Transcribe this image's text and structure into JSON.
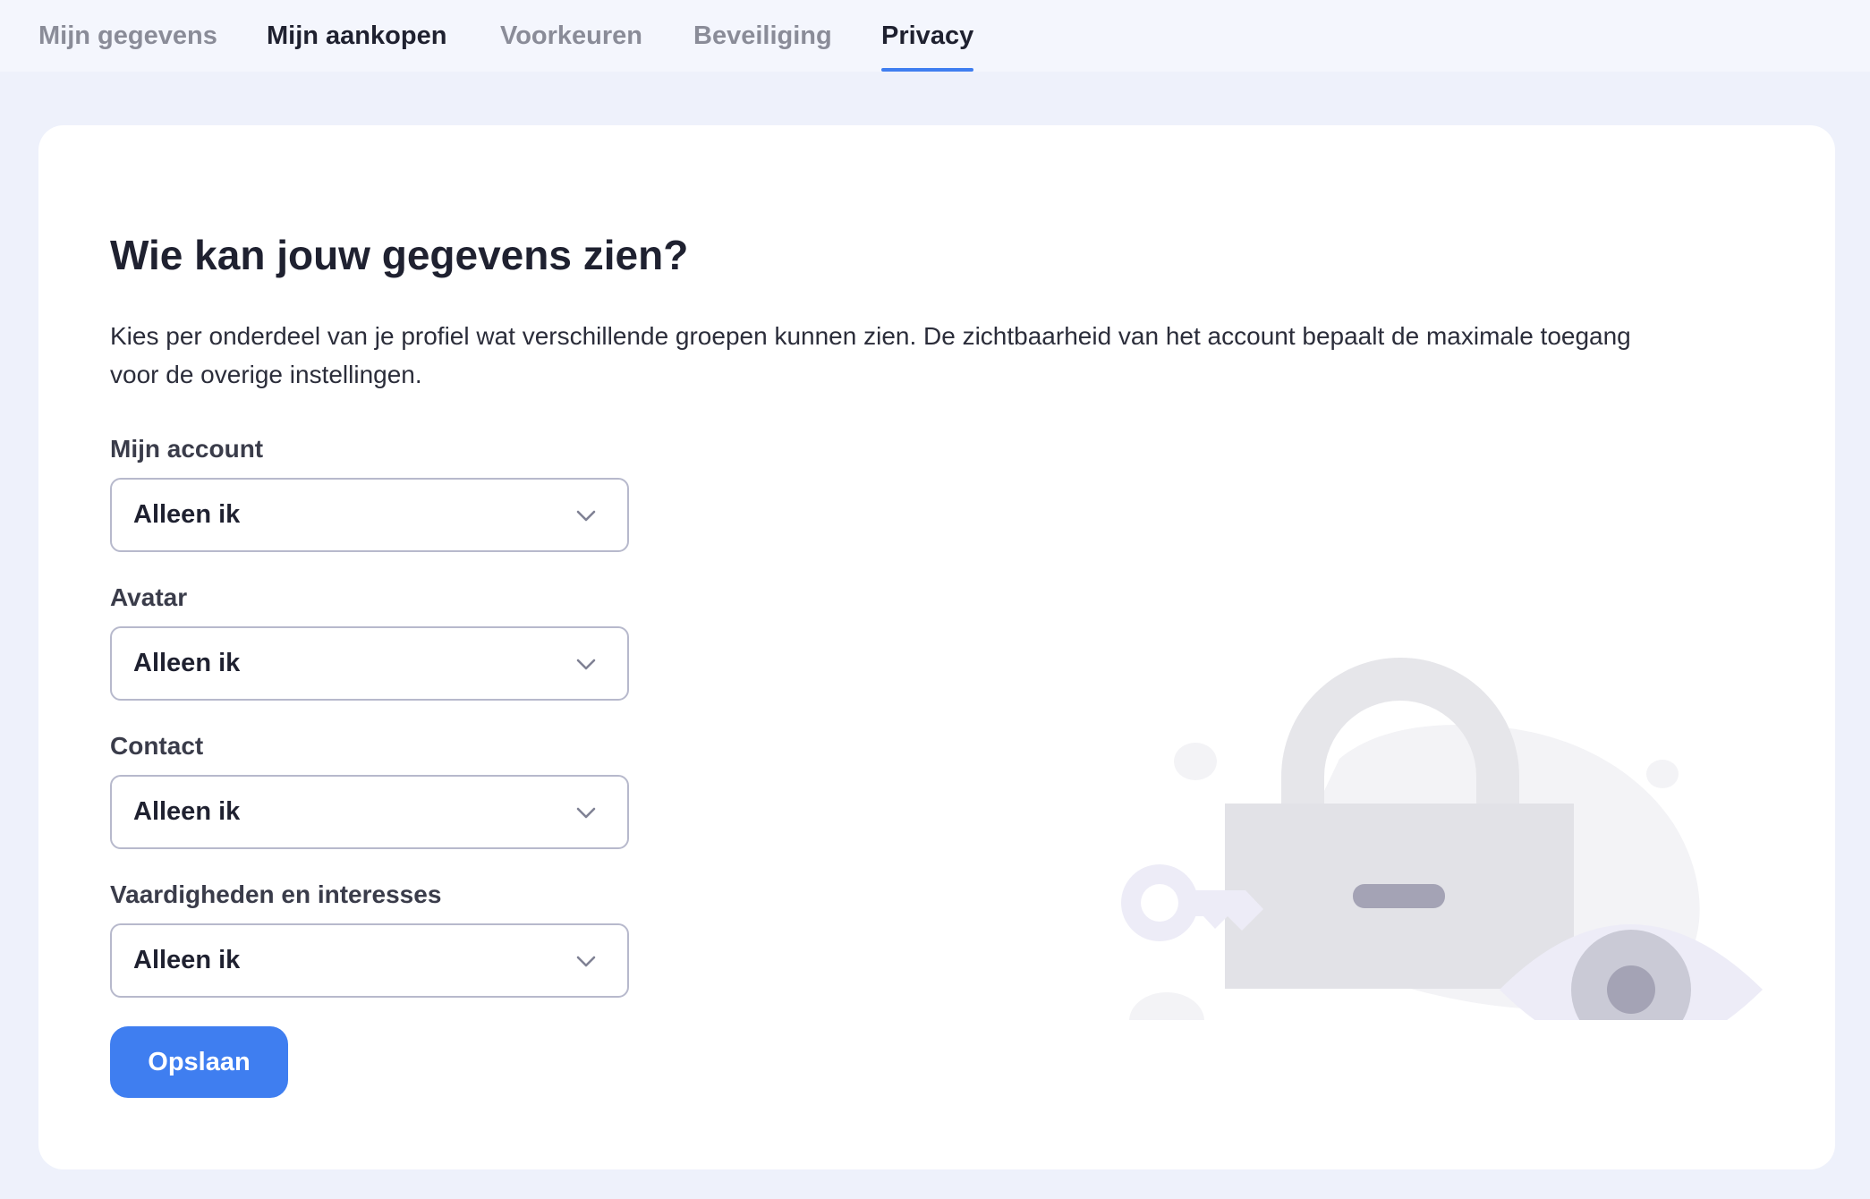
{
  "tabs": [
    {
      "label": "Mijn gegevens"
    },
    {
      "label": "Mijn aankopen"
    },
    {
      "label": "Voorkeuren"
    },
    {
      "label": "Beveiliging"
    },
    {
      "label": "Privacy"
    }
  ],
  "active_tab": "Privacy",
  "privacy": {
    "title": "Wie kan jouw gegevens zien?",
    "intro": "Kies per onderdeel van je profiel wat verschillende groepen kunnen zien. De zichtbaarheid van het account bepaalt de maximale toegang voor de overige instellingen.",
    "fields": [
      {
        "label": "Mijn account",
        "value": "Alleen ik"
      },
      {
        "label": "Avatar",
        "value": "Alleen ik"
      },
      {
        "label": "Contact",
        "value": "Alleen ik"
      },
      {
        "label": "Vaardigheden en interesses",
        "value": "Alleen ik"
      }
    ],
    "save_label": "Opslaan"
  },
  "colors": {
    "accent": "#3f7ef0",
    "background": "#eef1fb",
    "card": "#ffffff"
  },
  "icons": {
    "illustration": "padlock-key-eye-illustration",
    "select_caret": "chevron-down-icon"
  }
}
